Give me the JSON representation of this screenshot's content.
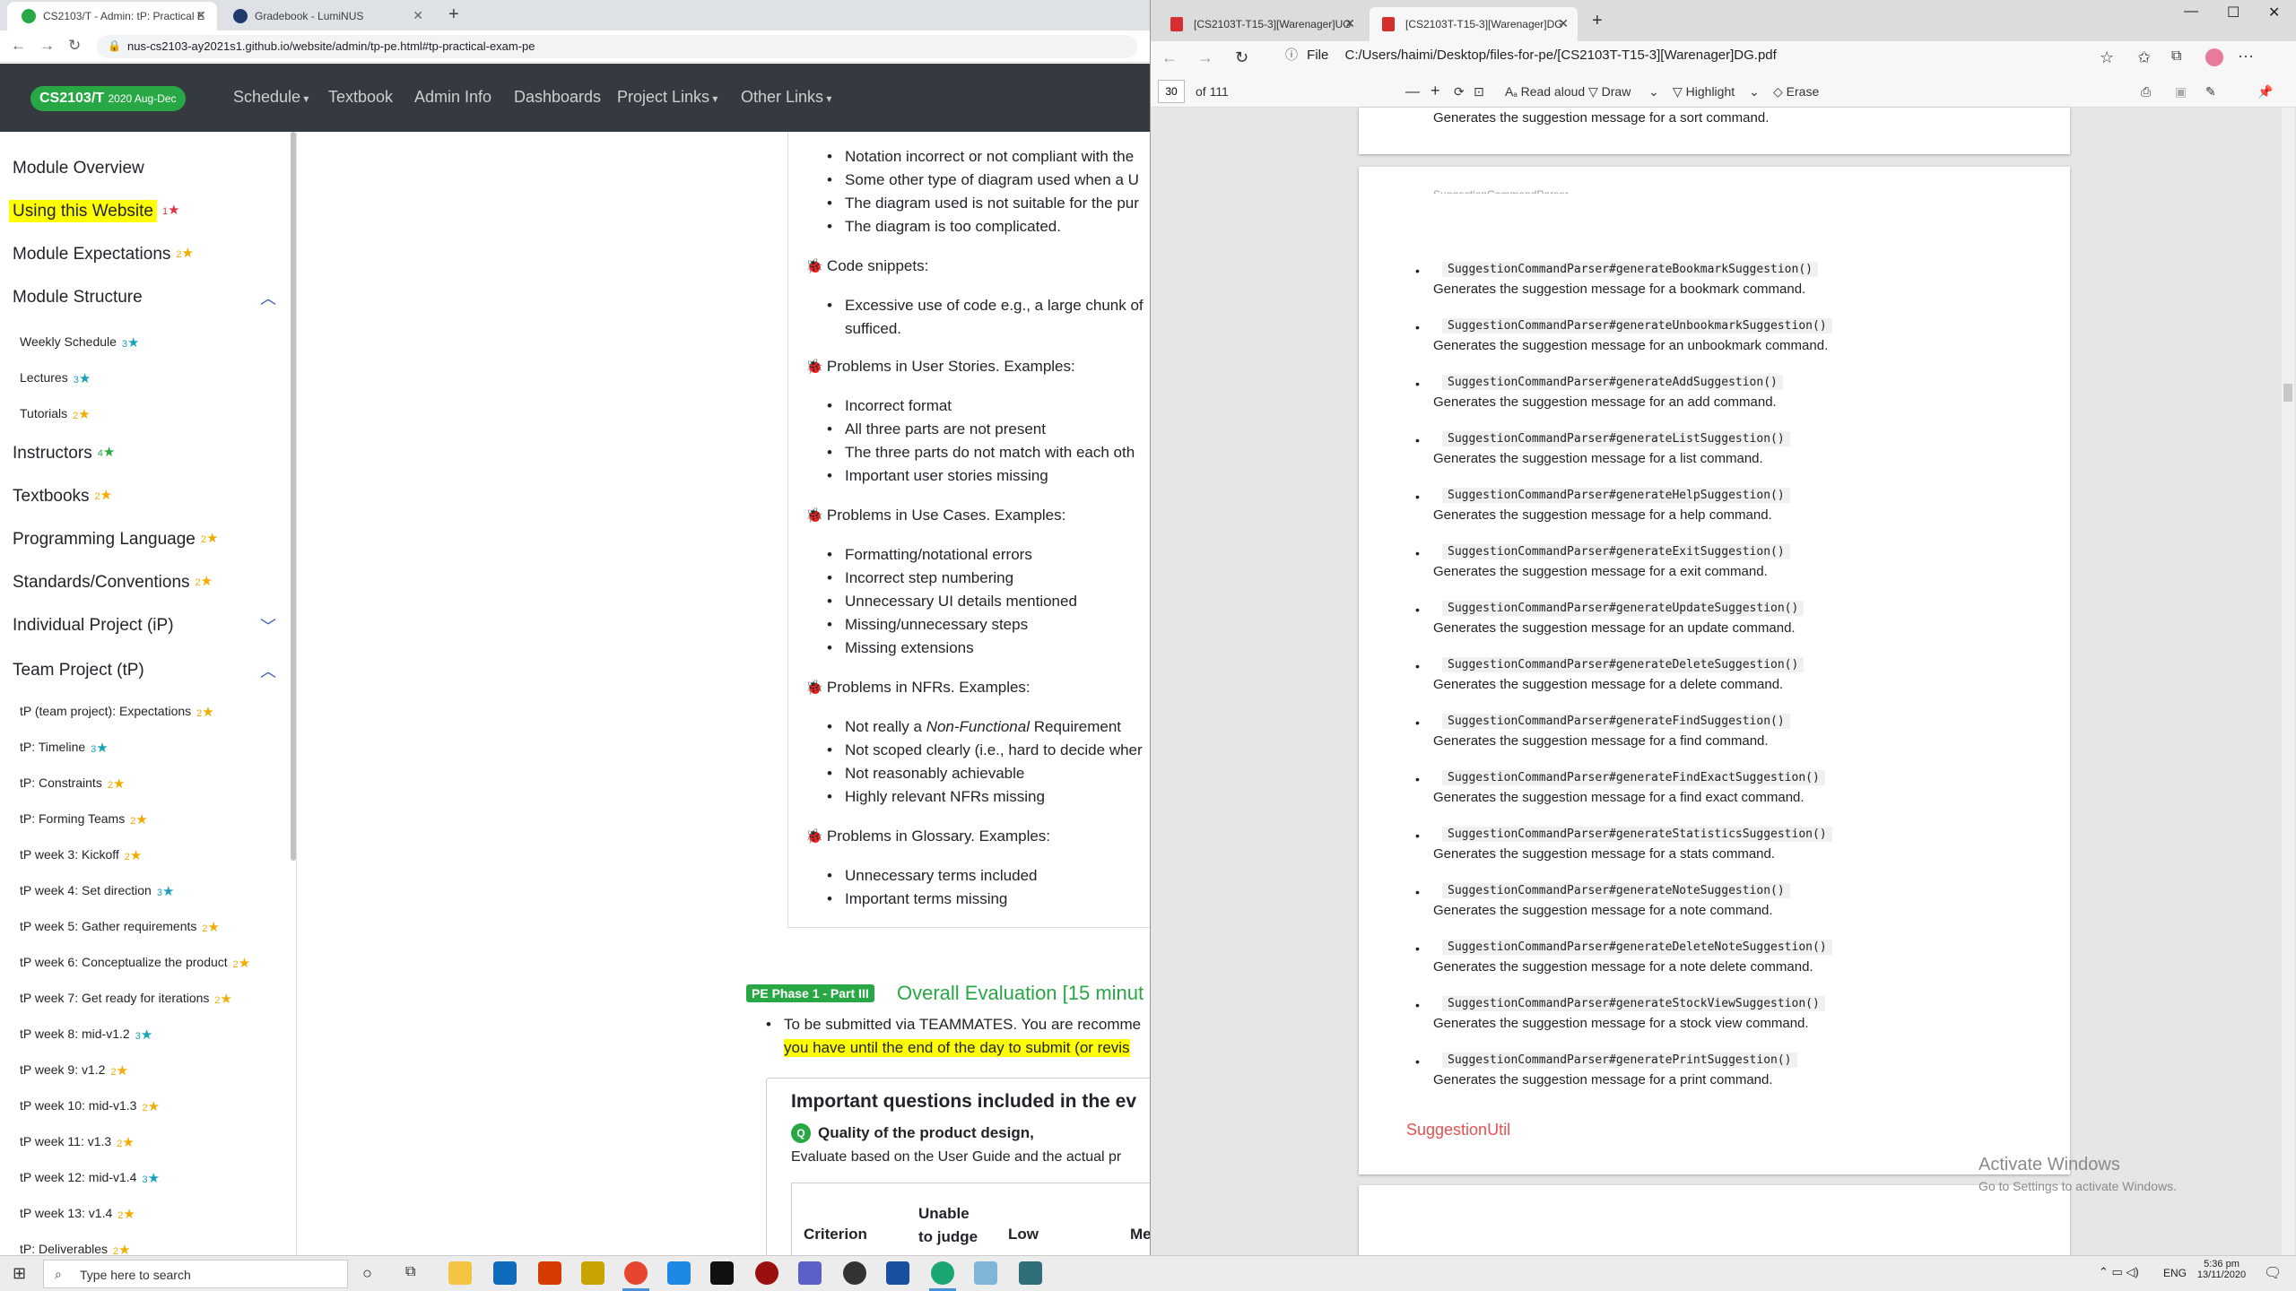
{
  "chrome": {
    "tabs": [
      {
        "title": "CS2103/T - Admin: tP: Practical E",
        "active": true
      },
      {
        "title": "Gradebook - LumiNUS",
        "active": false
      }
    ],
    "url": "nus-cs2103-ay2021s1.github.io/website/admin/tp-pe.html#tp-practical-exam-pe"
  },
  "site": {
    "brand": "CS2103/T",
    "brand_term": "2020 Aug-Dec",
    "nav": [
      "Schedule",
      "Textbook",
      "Admin Info",
      "Dashboards",
      "Project Links",
      "Other Links"
    ]
  },
  "sidebar": {
    "items": [
      {
        "label": "Module Overview",
        "level": "top",
        "stars": ""
      },
      {
        "label": "Using this Website",
        "level": "top",
        "stars": "1",
        "highlight": true
      },
      {
        "label": "Module Expectations",
        "level": "top",
        "stars": "2"
      },
      {
        "label": "Module Structure",
        "level": "top",
        "stars": ""
      },
      {
        "label": "Weekly Schedule",
        "level": "sub",
        "stars": "3"
      },
      {
        "label": "Lectures",
        "level": "sub",
        "stars": "3"
      },
      {
        "label": "Tutorials",
        "level": "sub",
        "stars": "2"
      },
      {
        "label": "Instructors",
        "level": "top",
        "stars": "4"
      },
      {
        "label": "Textbooks",
        "level": "top",
        "stars": "2"
      },
      {
        "label": "Programming Language",
        "level": "top",
        "stars": "2"
      },
      {
        "label": "Standards/Conventions",
        "level": "top",
        "stars": "2"
      },
      {
        "label": "Individual Project (iP)",
        "level": "top",
        "stars": ""
      },
      {
        "label": "Team Project (tP)",
        "level": "top",
        "stars": ""
      },
      {
        "label": "tP (team project): Expectations",
        "level": "sub",
        "stars": "2"
      },
      {
        "label": "tP: Timeline",
        "level": "sub",
        "stars": "3"
      },
      {
        "label": "tP: Constraints",
        "level": "sub",
        "stars": "2"
      },
      {
        "label": "tP: Forming Teams",
        "level": "sub",
        "stars": "2"
      },
      {
        "label": "tP week 3: Kickoff",
        "level": "sub",
        "stars": "2"
      },
      {
        "label": "tP week 4: Set direction",
        "level": "sub",
        "stars": "3"
      },
      {
        "label": "tP week 5: Gather requirements",
        "level": "sub",
        "stars": "2"
      },
      {
        "label": "tP week 6: Conceptualize the product",
        "level": "sub",
        "stars": "2"
      },
      {
        "label": "tP week 7: Get ready for iterations",
        "level": "sub",
        "stars": "2"
      },
      {
        "label": "tP week 8: mid-v1.2",
        "level": "sub",
        "stars": "3"
      },
      {
        "label": "tP week 9: v1.2",
        "level": "sub",
        "stars": "2"
      },
      {
        "label": "tP week 10: mid-v1.3",
        "level": "sub",
        "stars": "2"
      },
      {
        "label": "tP week 11: v1.3",
        "level": "sub",
        "stars": "2"
      },
      {
        "label": "tP week 12: mid-v1.4",
        "level": "sub",
        "stars": "3"
      },
      {
        "label": "tP week 13: v1.4",
        "level": "sub",
        "stars": "2"
      },
      {
        "label": "tP: Deliverables",
        "level": "sub",
        "stars": "2"
      }
    ]
  },
  "main": {
    "diagram_items": [
      "Notation incorrect or not compliant with the",
      "Some other type of diagram used when a U",
      "The diagram used is not suitable for the pur",
      "The diagram is too complicated."
    ],
    "code_heading": "Code snippets:",
    "code_items": [
      "Excessive use of code e.g., a large chunk of",
      "sufficed."
    ],
    "stories_heading": "Problems in User Stories. Examples:",
    "stories_items": [
      "Incorrect format",
      "All three parts are not present",
      "The three parts do not match with each oth",
      "Important user stories missing"
    ],
    "usecases_heading": "Problems in Use Cases. Examples:",
    "usecases_items": [
      "Formatting/notational errors",
      "Incorrect step numbering",
      "Unnecessary UI details mentioned",
      "Missing/unnecessary steps",
      "Missing extensions"
    ],
    "nfr_heading": "Problems in NFRs. Examples:",
    "nfr_items_pre": "Not really a ",
    "nfr_items_em": "Non-Functional",
    "nfr_items_post": " Requirement",
    "nfr_items": [
      "Not scoped clearly (i.e., hard to decide wher",
      "Not reasonably achievable",
      "Highly relevant NFRs missing"
    ],
    "glossary_heading": "Problems in Glossary. Examples:",
    "glossary_items": [
      "Unnecessary terms included",
      "Important terms missing"
    ],
    "pe_badge": "PE Phase 1 - Part III",
    "pe_title": "Overall Evaluation [15 minut",
    "pe_bullet1": "To be submitted via TEAMMATES. You are recomme",
    "pe_bullet2": "you have until the end of the day to submit (or revis",
    "box_title": "Important questions included in the ev",
    "q_badge": "Q",
    "q_title": "Quality of the product design,",
    "q_desc": "Evaluate based on the User Guide and the actual pr",
    "table_headers": [
      "Criterion",
      "Unable to judge",
      "Low",
      "Me"
    ]
  },
  "edge": {
    "tabs": [
      {
        "title": "[CS2103T-T15-3][Warenager]UG",
        "active": false
      },
      {
        "title": "[CS2103T-T15-3][Warenager]DG",
        "active": true
      }
    ],
    "file_label": "File",
    "path": "C:/Users/haimi/Desktop/files-for-pe/[CS2103T-T15-3][Warenager]DG.pdf",
    "page": "30",
    "page_total": "of 111",
    "toolbar": [
      "Read aloud",
      "Draw",
      "Highlight",
      "Erase"
    ],
    "prev_line": "Generates the suggestion message for a sort command.",
    "cut_heading": "SuggestionCommandParser",
    "methods": [
      {
        "fn": "SuggestionCommandParser#generateBookmarkSuggestion()",
        "desc": "Generates the suggestion message for a bookmark command."
      },
      {
        "fn": "SuggestionCommandParser#generateUnbookmarkSuggestion()",
        "desc": "Generates the suggestion message for an unbookmark command."
      },
      {
        "fn": "SuggestionCommandParser#generateAddSuggestion()",
        "desc": "Generates the suggestion message for an add command."
      },
      {
        "fn": "SuggestionCommandParser#generateListSuggestion()",
        "desc": "Generates the suggestion message for a list command."
      },
      {
        "fn": "SuggestionCommandParser#generateHelpSuggestion()",
        "desc": "Generates the suggestion message for a help command."
      },
      {
        "fn": "SuggestionCommandParser#generateExitSuggestion()",
        "desc": "Generates the suggestion message for a exit command."
      },
      {
        "fn": "SuggestionCommandParser#generateUpdateSuggestion()",
        "desc": "Generates the suggestion message for an update command."
      },
      {
        "fn": "SuggestionCommandParser#generateDeleteSuggestion()",
        "desc": "Generates the suggestion message for a delete command."
      },
      {
        "fn": "SuggestionCommandParser#generateFindSuggestion()",
        "desc": "Generates the suggestion message for a find command."
      },
      {
        "fn": "SuggestionCommandParser#generateFindExactSuggestion()",
        "desc": "Generates the suggestion message for a find exact command."
      },
      {
        "fn": "SuggestionCommandParser#generateStatisticsSuggestion()",
        "desc": "Generates the suggestion message for a stats command."
      },
      {
        "fn": "SuggestionCommandParser#generateNoteSuggestion()",
        "desc": "Generates the suggestion message for a note command."
      },
      {
        "fn": "SuggestionCommandParser#generateDeleteNoteSuggestion()",
        "desc": "Generates the suggestion message for a note delete command."
      },
      {
        "fn": "SuggestionCommandParser#generateStockViewSuggestion()",
        "desc": "Generates the suggestion message for a stock view command."
      },
      {
        "fn": "SuggestionCommandParser#generatePrintSuggestion()",
        "desc": "Generates the suggestion message for a print command."
      }
    ],
    "section_title": "SuggestionUtil",
    "activate_title": "Activate Windows",
    "activate_sub": "Go to Settings to activate Windows."
  },
  "taskbar": {
    "search_placeholder": "Type here to search",
    "lang": "ENG",
    "time": "5:36 pm",
    "date": "13/11/2020"
  }
}
